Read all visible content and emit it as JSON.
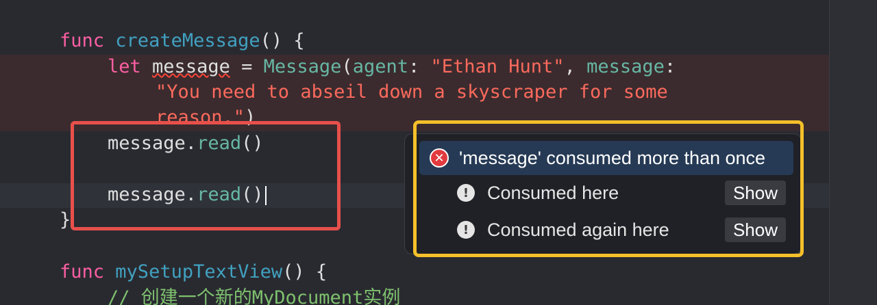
{
  "code": {
    "line1": {
      "kw": "func",
      "name": "createMessage",
      "rest": "() {"
    },
    "line2": {
      "kw": "let",
      "var": "message",
      "eq": " = ",
      "type": "Message",
      "p1": "(",
      "label1": "agent",
      "colon1": ": ",
      "str1": "\"Ethan Hunt\"",
      "comma": ", ",
      "label2": "message",
      "colon2": ":"
    },
    "line3": {
      "str": "\"You need to abseil down a skyscraper for some"
    },
    "line4": {
      "str": "reason.\"",
      "close": ")"
    },
    "line5": {
      "obj": "message",
      "dot": ".",
      "method": "read",
      "paren": "()"
    },
    "line7": {
      "obj": "message",
      "dot": ".",
      "method": "read",
      "paren": "()"
    },
    "line8": {
      "text": "}"
    },
    "line10": {
      "kw": "func",
      "name": "mySetupTextView",
      "rest": "() {"
    },
    "line11": {
      "comment": "// 创建一个新的MyDocument实例"
    }
  },
  "diagnostic": {
    "title": "'message' consumed more than once",
    "notes": [
      {
        "text": "Consumed here",
        "button": "Show"
      },
      {
        "text": "Consumed again here",
        "button": "Show"
      }
    ]
  },
  "colors": {
    "editor_bg": "#292a30",
    "error_band": "#3b2b2e",
    "highlight_red": "#e8504b",
    "highlight_yellow": "#f5c02a",
    "popover_title_bg": "#263a55"
  },
  "icons": {
    "error": "error-x-icon",
    "note": "exclamation-note-icon"
  }
}
